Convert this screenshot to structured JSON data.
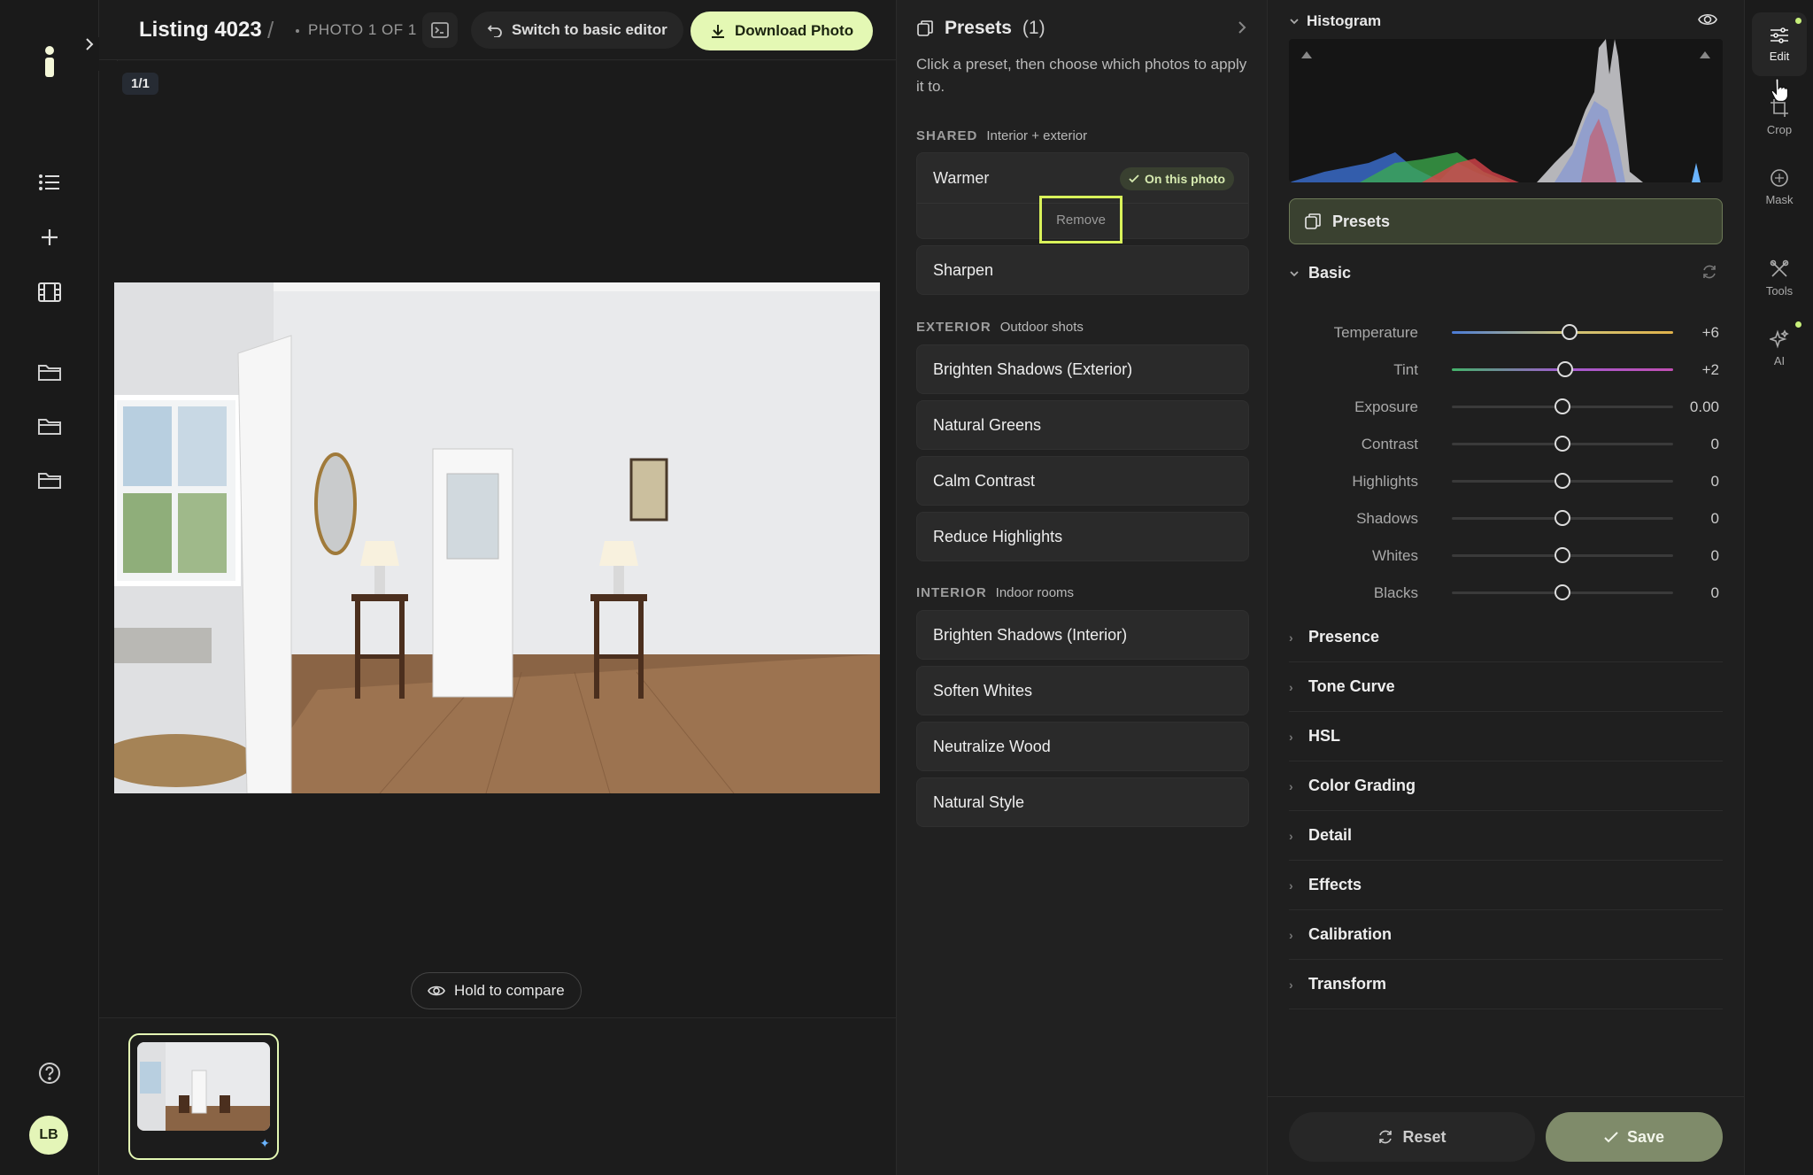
{
  "topbar": {
    "title": "Listing 4023",
    "separator": "/",
    "photo_counter": "PHOTO 1 OF 1",
    "switch_label": "Switch to basic editor",
    "download_label": "Download Photo"
  },
  "canvas": {
    "page_badge": "1/1",
    "compare_label": "Hold to compare"
  },
  "user": {
    "initials": "LB"
  },
  "presets_panel": {
    "title": "Presets",
    "count": "(1)",
    "description": "Click a preset, then choose which photos to apply it to.",
    "sections": [
      {
        "name": "SHARED",
        "sub": "Interior + exterior",
        "items": [
          "Warmer",
          "Sharpen"
        ]
      },
      {
        "name": "EXTERIOR",
        "sub": "Outdoor shots",
        "items": [
          "Brighten Shadows (Exterior)",
          "Natural Greens",
          "Calm Contrast",
          "Reduce Highlights"
        ]
      },
      {
        "name": "INTERIOR",
        "sub": "Indoor rooms",
        "items": [
          "Brighten Shadows (Interior)",
          "Soften Whites",
          "Neutralize Wood",
          "Natural Style"
        ]
      }
    ],
    "applied_badge": "On this photo",
    "remove_label": "Remove"
  },
  "adjust_panel": {
    "histogram_title": "Histogram",
    "presets_button": "Presets",
    "basic_title": "Basic",
    "sliders": [
      {
        "label": "Temperature",
        "value": "+6",
        "position": 0.53
      },
      {
        "label": "Tint",
        "value": "+2",
        "position": 0.51
      },
      {
        "label": "Exposure",
        "value": "0.00",
        "position": 0.5
      },
      {
        "label": "Contrast",
        "value": "0",
        "position": 0.5
      },
      {
        "label": "Highlights",
        "value": "0",
        "position": 0.5
      },
      {
        "label": "Shadows",
        "value": "0",
        "position": 0.5
      },
      {
        "label": "Whites",
        "value": "0",
        "position": 0.5
      },
      {
        "label": "Blacks",
        "value": "0",
        "position": 0.5
      }
    ],
    "sections": [
      "Presence",
      "Tone Curve",
      "HSL",
      "Color Grading",
      "Detail",
      "Effects",
      "Calibration",
      "Transform"
    ],
    "reset_label": "Reset",
    "save_label": "Save"
  },
  "tools": [
    {
      "label": "Edit",
      "icon": "sliders-icon"
    },
    {
      "label": "Crop",
      "icon": "crop-icon"
    },
    {
      "label": "Mask",
      "icon": "mask-icon"
    },
    {
      "label": "Tools",
      "icon": "tools-icon"
    },
    {
      "label": "AI",
      "icon": "sparkle-icon"
    }
  ],
  "colors": {
    "accent": "#e4f8b4",
    "highlight_outline": "#d9f25a",
    "save": "#7f8b6a"
  }
}
